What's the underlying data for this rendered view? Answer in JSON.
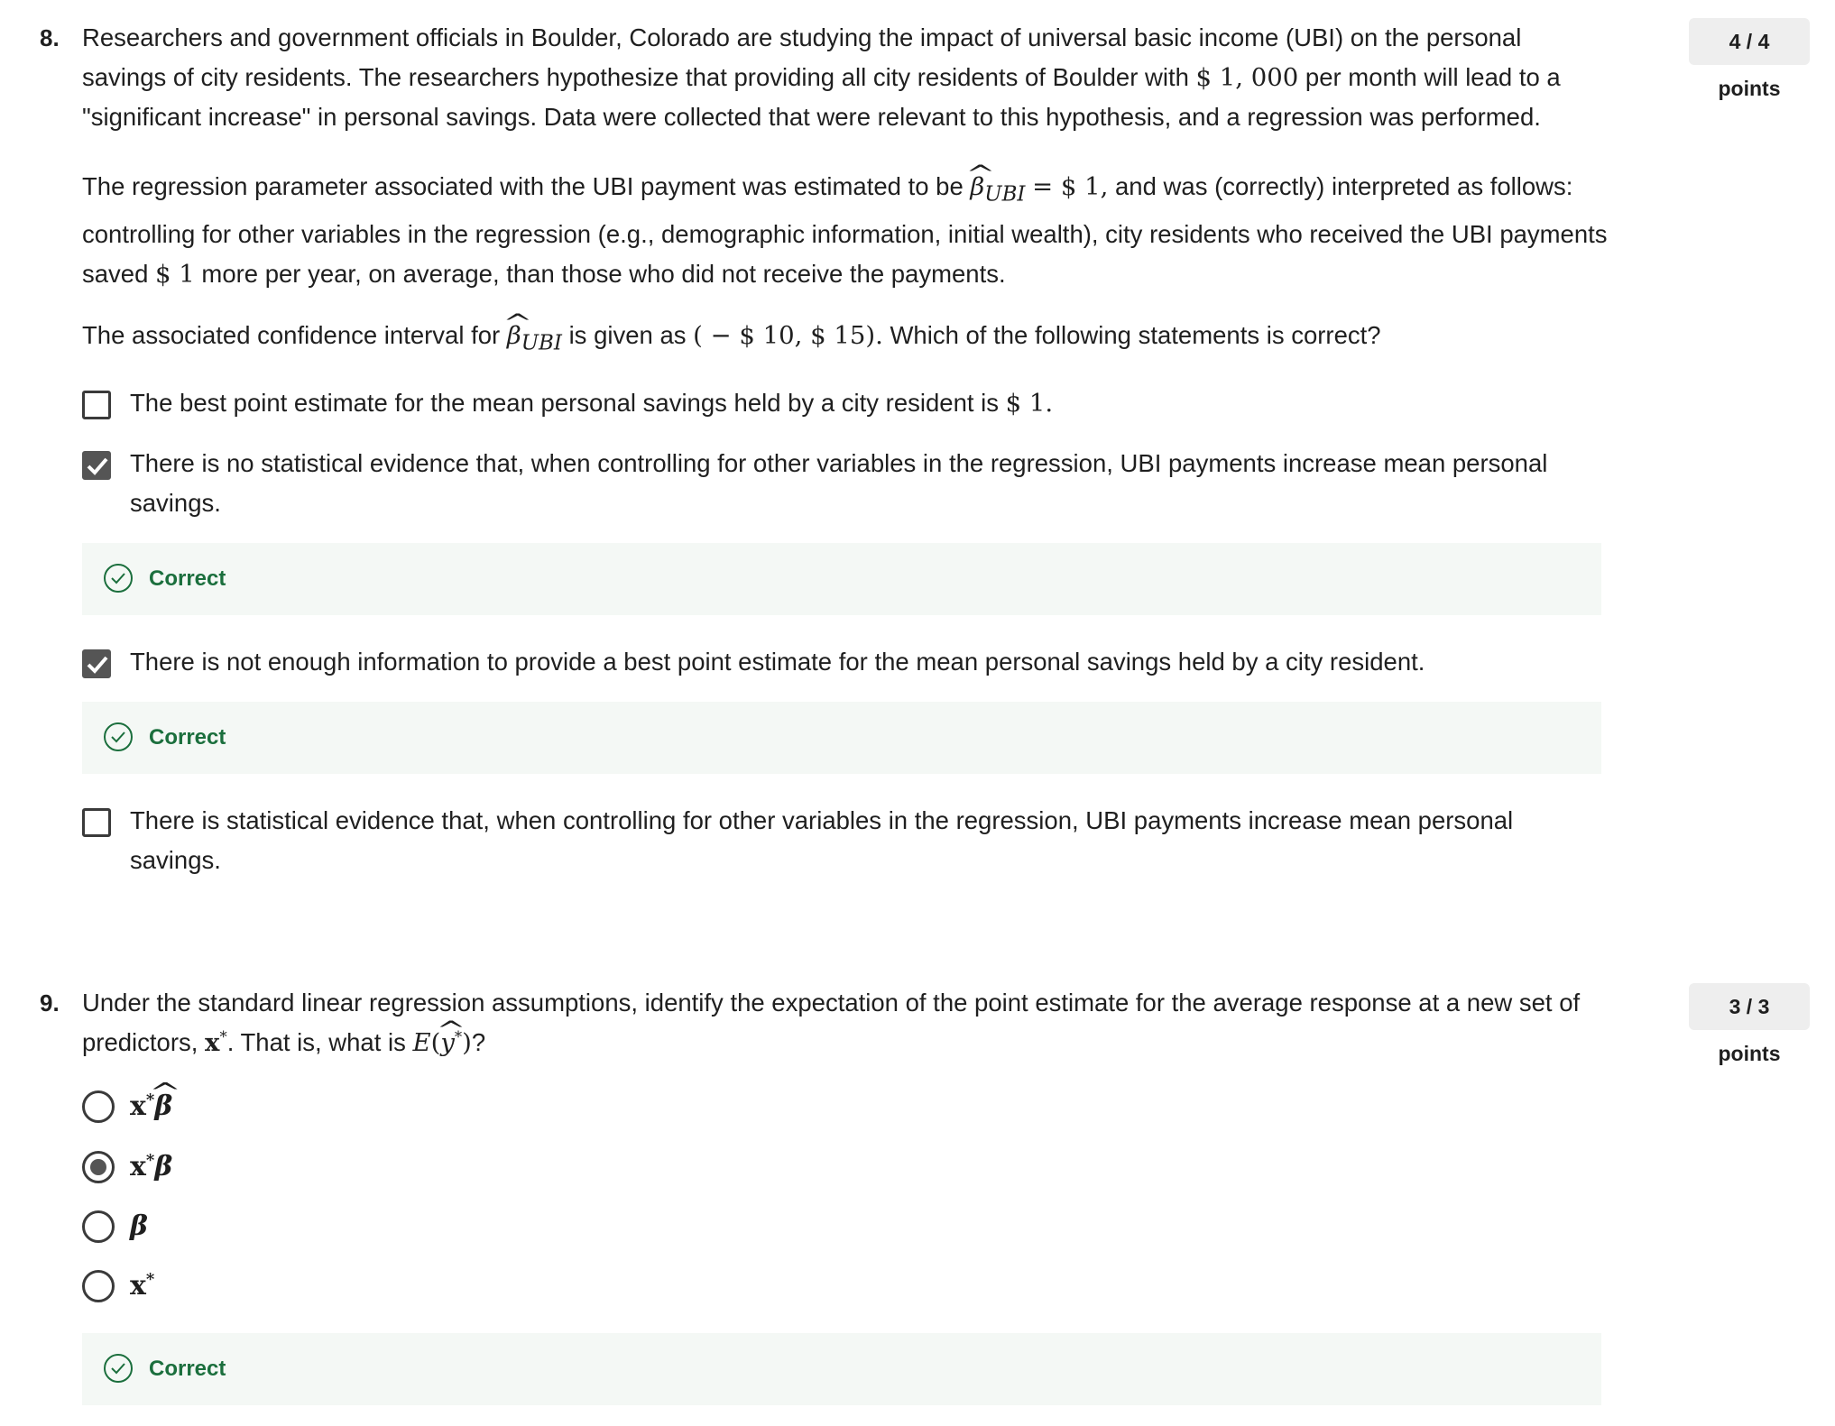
{
  "questions": [
    {
      "number": "8.",
      "points": "4 / 4 points",
      "prompt": "Researchers and government officials in Boulder, Colorado are studying the impact of universal basic income (UBI) on the personal savings of city residents. The researchers hypothesize that providing all city residents of Boulder with",
      "prompt_money": "$ 1, 000",
      "prompt_tail": "per month will lead to a \"significant increase\" in personal savings. Data were collected that were relevant to this hypothesis, and a regression was performed.",
      "para2_a": "The regression parameter associated with the UBI payment was estimated to be",
      "para2_beta": "β",
      "para2_sub": "UBI",
      "para2_eq": "=  $ 1,",
      "para2_b": "and was (correctly) interpreted as follows: controlling for other variables in the regression (e.g., demographic information, initial wealth), city residents who received the UBI payments saved",
      "para2_money": "$ 1",
      "para2_c": "more per year, on average, than those who did not receive the payments.",
      "para3_a": "The associated confidence interval for",
      "para3_beta": "β",
      "para3_sub": "UBI",
      "para3_b": "is given as",
      "para3_interval": "( −  $ 10,  $ 15).",
      "para3_c": "Which of the following statements is correct?",
      "options": [
        {
          "text": "The best point estimate for the mean personal savings held by a city resident is",
          "money": "$ 1.",
          "checked": false
        },
        {
          "text": "There is no statistical evidence that, when controlling for other variables in the regression, UBI payments increase mean personal savings.",
          "checked": true,
          "feedback": "Correct"
        },
        {
          "text": "There is not enough information to provide a best point estimate for the mean personal savings held by a city resident.",
          "checked": true,
          "feedback": "Correct"
        },
        {
          "text": "There is statistical evidence that, when controlling for other variables in the regression, UBI payments increase mean personal savings.",
          "checked": false
        }
      ]
    },
    {
      "number": "9.",
      "points": "3 / 3 points",
      "prompt_a": "Under the standard linear regression assumptions, identify the expectation of the point estimate for the average response at a new set of predictors,",
      "prompt_x": "x",
      "prompt_b": ". That is, what is",
      "prompt_E": "E",
      "prompt_y": "y",
      "prompt_c": "?",
      "options": [
        {
          "label_x": "x",
          "label_beta": "β",
          "hat": true,
          "selected": false
        },
        {
          "label_x": "x",
          "label_beta": "β",
          "hat": false,
          "selected": true
        },
        {
          "label_x": "",
          "label_beta": "β",
          "hat": false,
          "selected": false
        },
        {
          "label_x": "x",
          "label_beta": "",
          "hat": false,
          "selected": false
        }
      ],
      "feedback": "Correct"
    }
  ],
  "colors": {
    "correct_text": "#1b6f3d",
    "correct_bg": "#f4f8f5",
    "badge_bg": "#eeeeee",
    "checked_fill": "#555555"
  },
  "icons": {
    "checkmark": "check-icon",
    "correct": "check-circle-icon"
  }
}
